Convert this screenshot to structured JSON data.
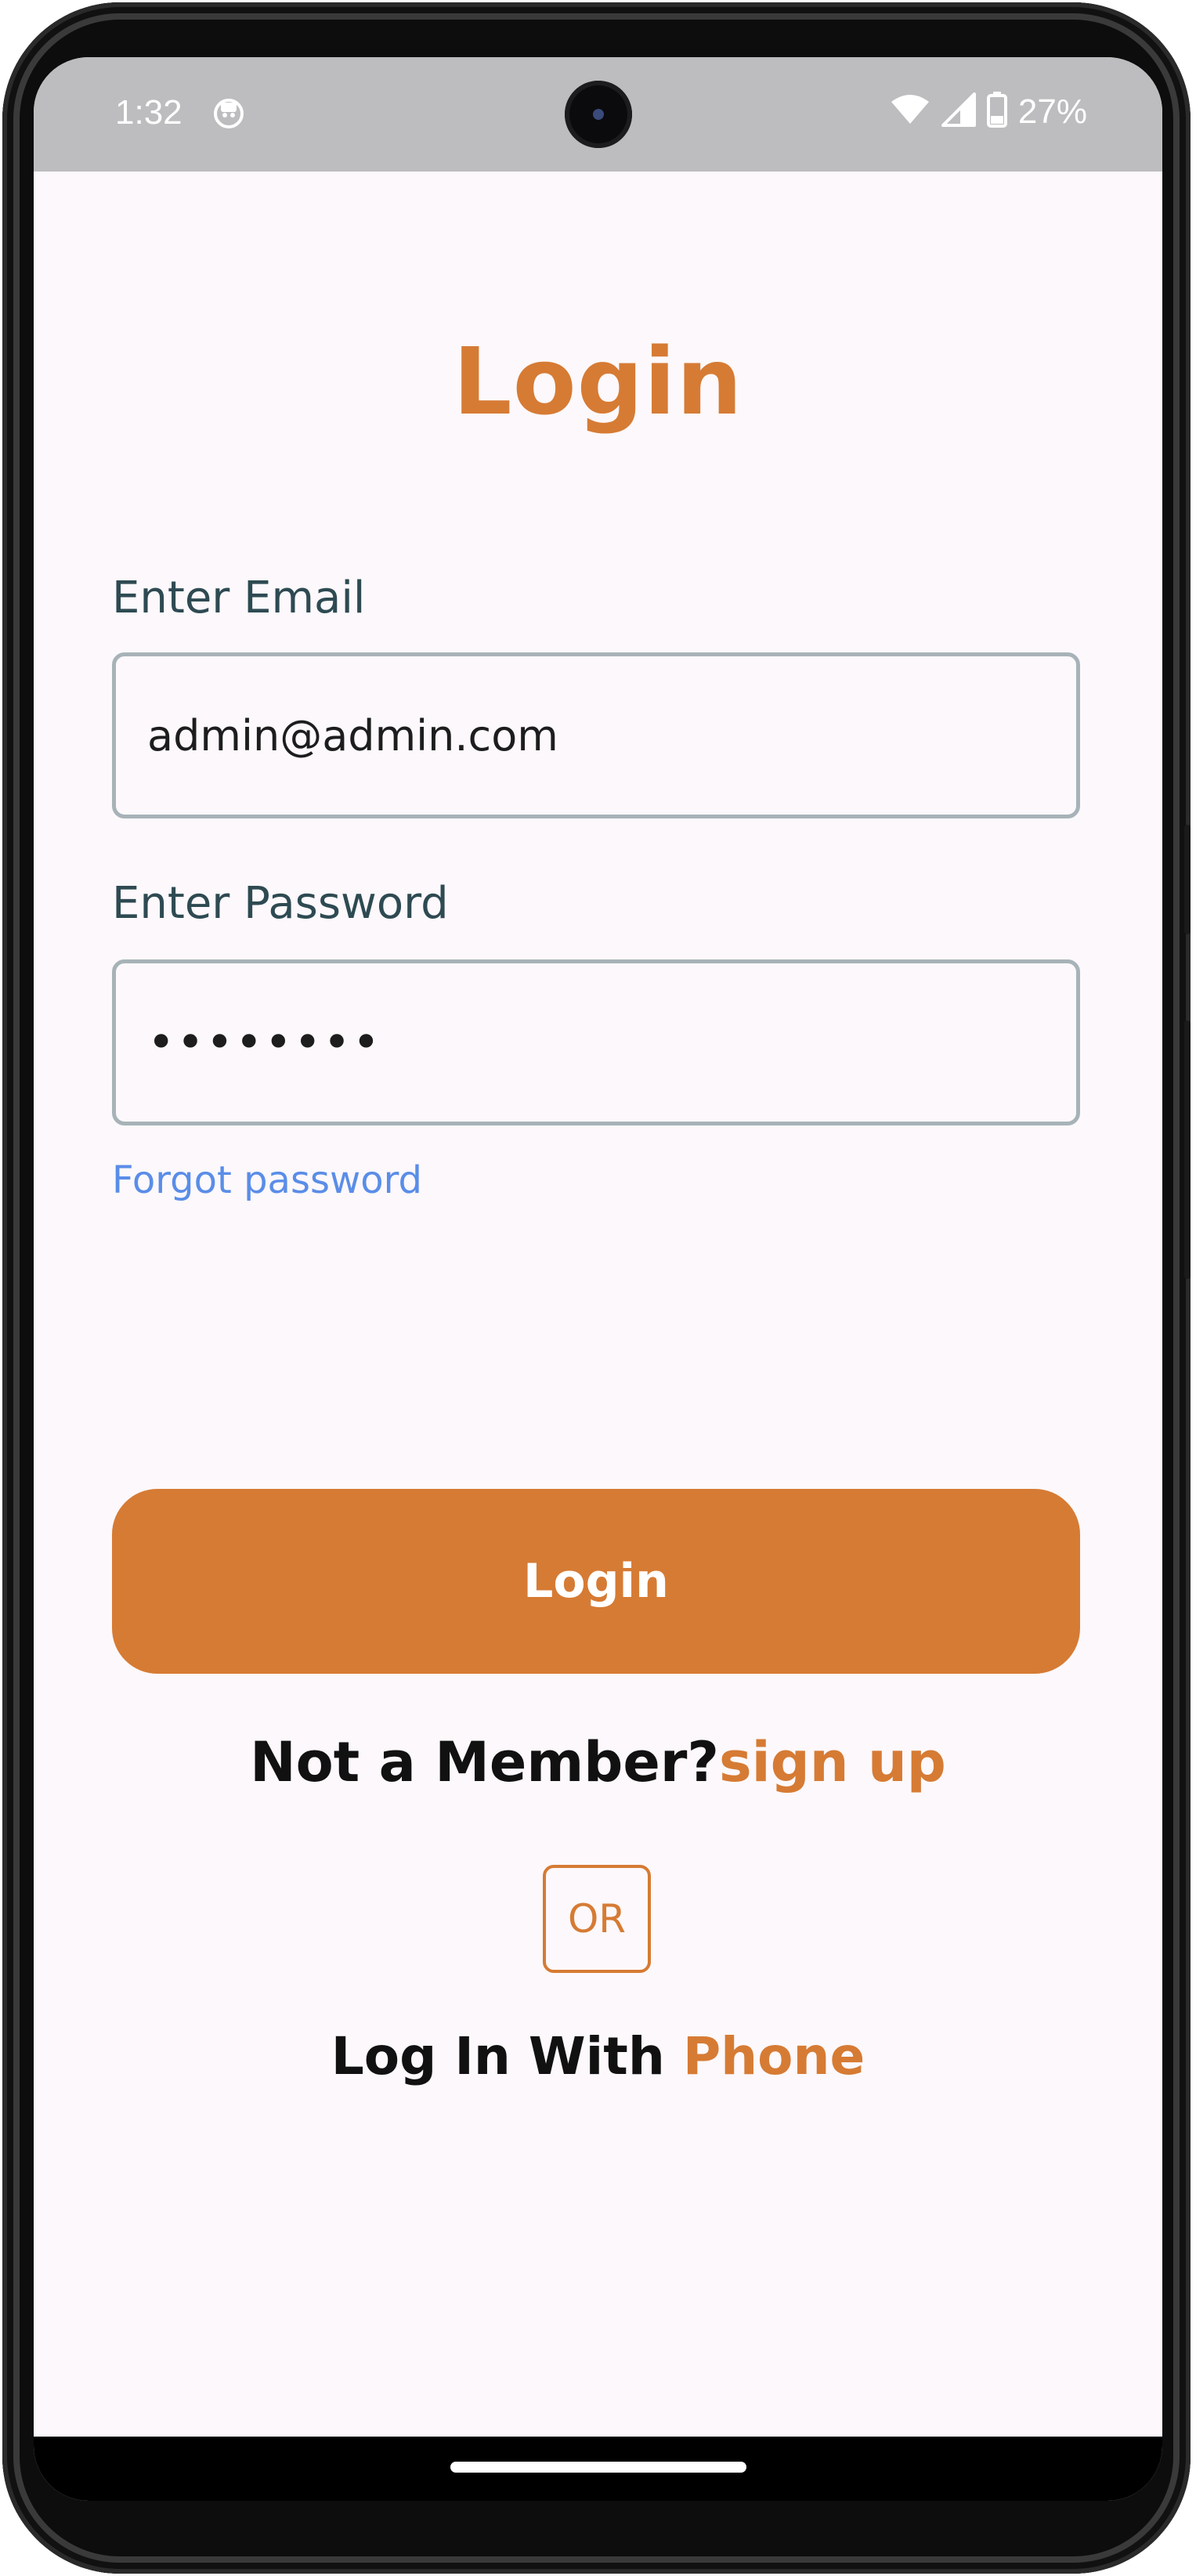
{
  "status_bar": {
    "time": "1:32",
    "battery": "27%",
    "icons": [
      "app-notification-icon",
      "wifi-icon",
      "signal-icon",
      "battery-icon"
    ]
  },
  "screen": {
    "title": "Login",
    "email": {
      "label": "Enter Email",
      "value": "admin@admin.com"
    },
    "password": {
      "label": "Enter Password",
      "value": "••••••••"
    },
    "forgot_password": "Forgot password",
    "login_button": "Login",
    "signup": {
      "prompt": "Not a Member?",
      "link": "sign up"
    },
    "or_label": "OR",
    "phone_login": {
      "prefix": "Log In With ",
      "link": "Phone"
    }
  },
  "colors": {
    "accent": "#d67b34",
    "link_blue": "#5a8de8",
    "label": "#2e4a52",
    "background": "#fcf8fb"
  }
}
